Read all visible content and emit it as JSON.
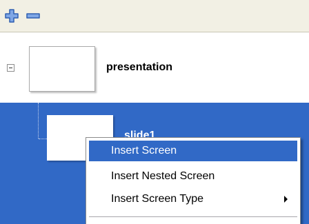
{
  "toolbar": {
    "add_icon": "plus-icon",
    "remove_icon": "minus-icon",
    "icon_color": "#3a71c8"
  },
  "tree": {
    "root": {
      "label": "presentation",
      "expander": "minus"
    },
    "child": {
      "label": "slide1",
      "selected": true
    }
  },
  "context_menu": {
    "items": [
      {
        "label": "Insert Screen",
        "highlighted": true,
        "has_submenu": false
      },
      {
        "label": "Insert Nested Screen",
        "highlighted": false,
        "has_submenu": false
      },
      {
        "label": "Insert Screen Type",
        "highlighted": false,
        "has_submenu": true
      }
    ]
  },
  "colors": {
    "selection": "#3169c6",
    "toolbar_bg": "#f2f0e4"
  }
}
